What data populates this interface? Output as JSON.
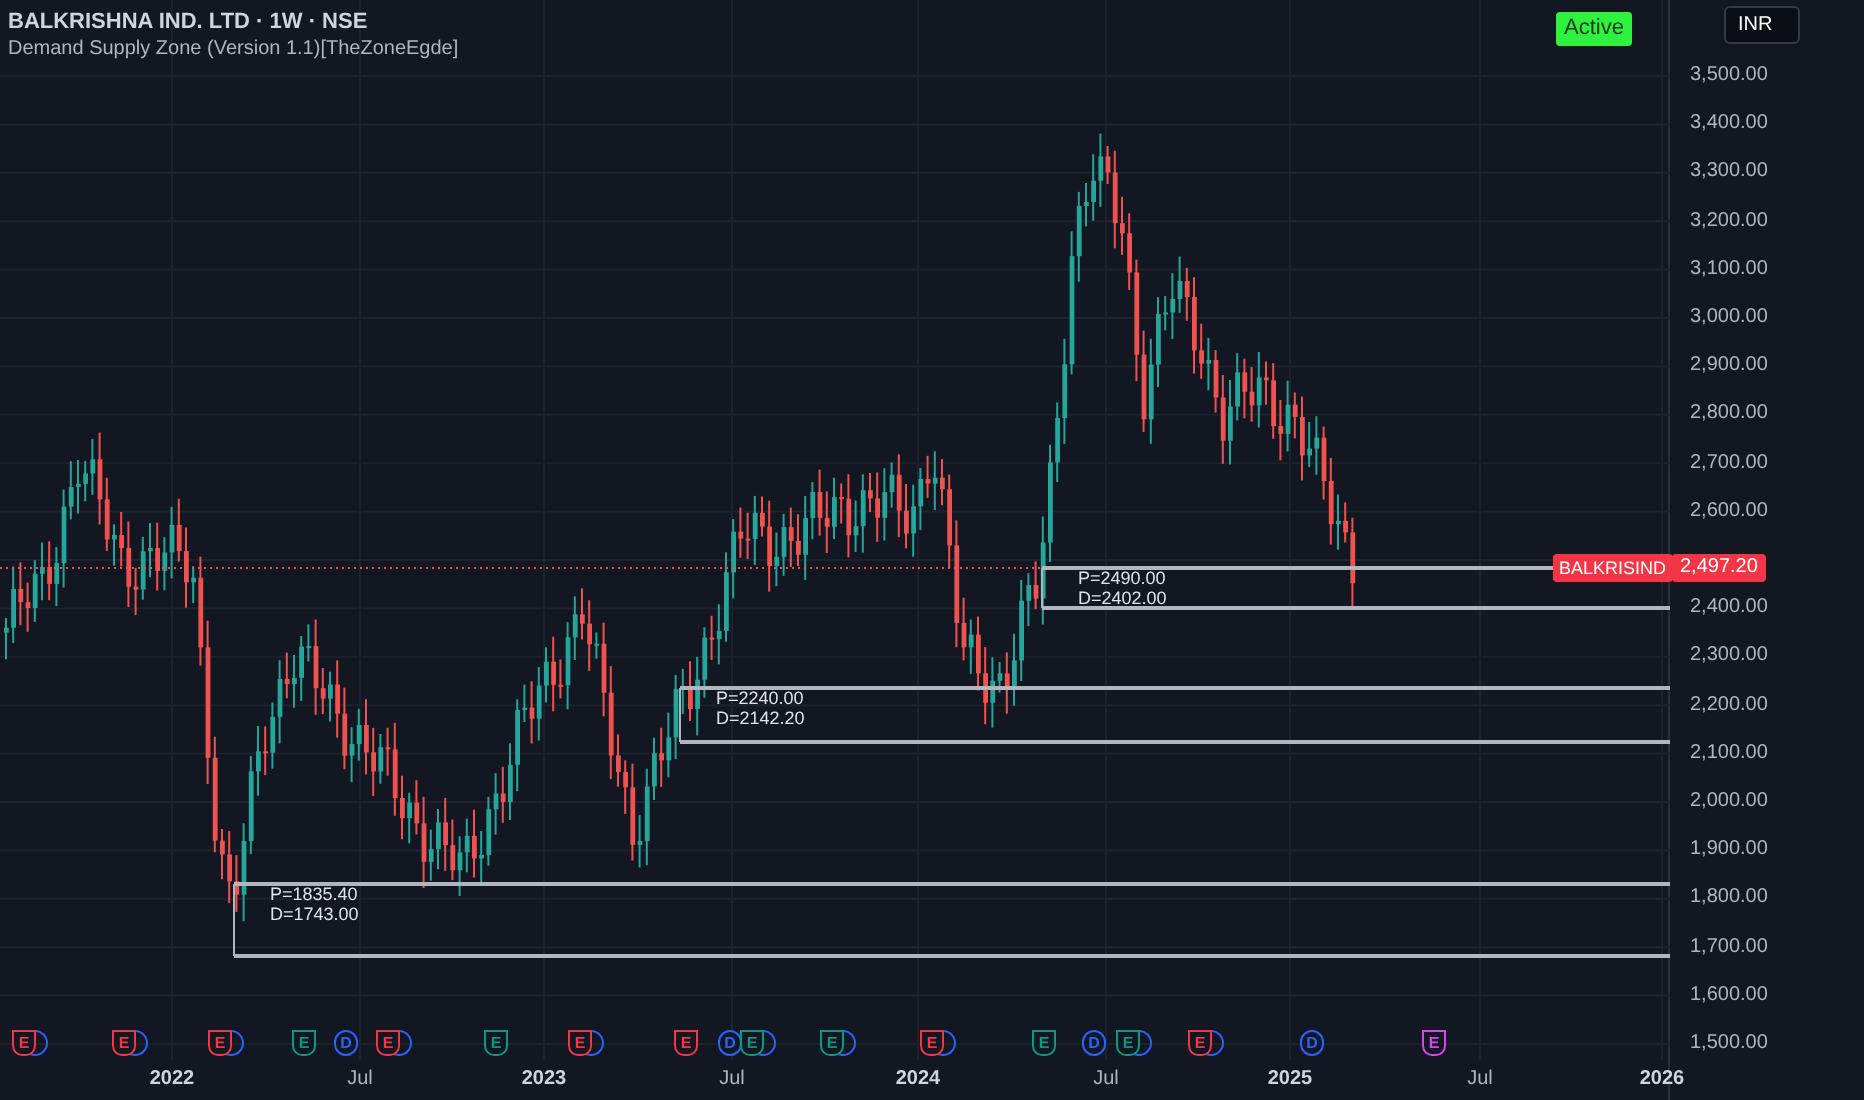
{
  "header": {
    "title": "BALKRISHNA IND. LTD · 1W · NSE",
    "indicator": "Demand Supply Zone (Version 1.1)[TheZoneEgde]"
  },
  "status_badge": "Active",
  "currency": "INR",
  "price_axis": [
    "3,500.00",
    "3,400.00",
    "3,300.00",
    "3,200.00",
    "3,100.00",
    "3,000.00",
    "2,900.00",
    "2,800.00",
    "2,700.00",
    "2,600.00",
    "2,400.00",
    "2,300.00",
    "2,200.00",
    "2,100.00",
    "2,000.00",
    "1,900.00",
    "1,800.00",
    "1,700.00",
    "1,600.00",
    "1,500.00"
  ],
  "last_price": {
    "symbol": "BALKRISIND",
    "value": "2,497.20"
  },
  "zones": [
    {
      "p": "P=2490.00",
      "d": "D=2402.00"
    },
    {
      "p": "P=2240.00",
      "d": "D=2142.20"
    },
    {
      "p": "P=1835.40",
      "d": "D=1743.00"
    }
  ],
  "time_axis": [
    {
      "label": "2022",
      "kind": "year"
    },
    {
      "label": "Jul",
      "kind": "month"
    },
    {
      "label": "2023",
      "kind": "year"
    },
    {
      "label": "Jul",
      "kind": "month"
    },
    {
      "label": "2024",
      "kind": "year"
    },
    {
      "label": "Jul",
      "kind": "month"
    },
    {
      "label": "2025",
      "kind": "year"
    },
    {
      "label": "Jul",
      "kind": "month"
    },
    {
      "label": "2026",
      "kind": "year"
    }
  ],
  "events": [
    {
      "letter": "E",
      "color": "#f23645",
      "stacked": true
    },
    {
      "letter": "E",
      "color": "#f23645",
      "stacked": true
    },
    {
      "letter": "E",
      "color": "#f23645",
      "stacked": true
    },
    {
      "letter": "E",
      "color": "#089981",
      "stacked": false
    },
    {
      "letter": "D",
      "color": "#2962ff",
      "stacked": false
    },
    {
      "letter": "E",
      "color": "#f23645",
      "stacked": true
    },
    {
      "letter": "E",
      "color": "#089981",
      "stacked": false
    },
    {
      "letter": "E",
      "color": "#f23645",
      "stacked": true
    },
    {
      "letter": "E",
      "color": "#f23645",
      "stacked": false
    },
    {
      "letter": "D",
      "color": "#2962ff",
      "stacked": false
    },
    {
      "letter": "E",
      "color": "#089981",
      "stacked": true
    },
    {
      "letter": "E",
      "color": "#089981",
      "stacked": true
    },
    {
      "letter": "E",
      "color": "#f23645",
      "stacked": true
    },
    {
      "letter": "E",
      "color": "#089981",
      "stacked": false
    },
    {
      "letter": "D",
      "color": "#2962ff",
      "stacked": false
    },
    {
      "letter": "E",
      "color": "#089981",
      "stacked": true
    },
    {
      "letter": "E",
      "color": "#f23645",
      "stacked": true
    },
    {
      "letter": "D",
      "color": "#2962ff",
      "stacked": false
    },
    {
      "letter": "E",
      "color": "#e040fb",
      "stacked": false
    }
  ]
}
